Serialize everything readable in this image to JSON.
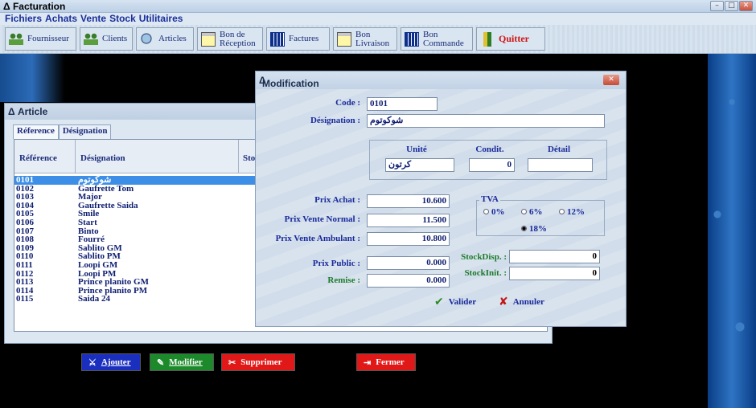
{
  "app": {
    "title": "Facturation"
  },
  "menu": [
    "Fichiers",
    "Achats",
    "Vente",
    "Stock",
    "Utilitaires"
  ],
  "toolbar": {
    "fournisseur": "Fournisseur",
    "clients": "Clients",
    "articles": "Articles",
    "bon_reception_1": "Bon de",
    "bon_reception_2": "Réception",
    "factures": "Factures",
    "bon_livraison_1": "Bon",
    "bon_livraison_2": "Livraison",
    "bon_commande_1": "Bon",
    "bon_commande_2": "Commande",
    "quitter": "Quitter"
  },
  "article_window": {
    "title": "Article",
    "tabs": [
      "Réference",
      "Désignation"
    ],
    "columns": [
      "Référence",
      "Désignation",
      "Sto"
    ],
    "rows": [
      {
        "ref": "0101",
        "designation": "شوكوتوم",
        "selected": true
      },
      {
        "ref": "0102",
        "designation": "Gaufrette Tom"
      },
      {
        "ref": "0103",
        "designation": "Major"
      },
      {
        "ref": "0104",
        "designation": "Gaufrette Saida"
      },
      {
        "ref": "0105",
        "designation": "Smile"
      },
      {
        "ref": "0106",
        "designation": "Start"
      },
      {
        "ref": "0107",
        "designation": "Binto"
      },
      {
        "ref": "0108",
        "designation": "Fourré"
      },
      {
        "ref": "0109",
        "designation": "Sablito GM"
      },
      {
        "ref": "0110",
        "designation": "Sablito PM"
      },
      {
        "ref": "0111",
        "designation": "Loopi GM"
      },
      {
        "ref": "0112",
        "designation": "Loopi PM"
      },
      {
        "ref": "0113",
        "designation": "Prince planito GM"
      },
      {
        "ref": "0114",
        "designation": "Prince planito PM"
      },
      {
        "ref": "0115",
        "designation": "Saida 24"
      }
    ],
    "buttons": {
      "ajouter": "Ajouter",
      "modifier": "Modifier",
      "supprimer": "Supprimer",
      "fermer": "Fermer"
    }
  },
  "dialog": {
    "title": "Modification",
    "code_label": "Code :",
    "code_value": "0101",
    "designation_label": "Désignation :",
    "designation_value": "شوكوتوم",
    "unite_label": "Unité",
    "unite_value": "كرتون",
    "condit_label": "Condit.",
    "condit_value": "0",
    "detail_label": "Détail",
    "detail_value": "",
    "prix_achat_label": "Prix Achat :",
    "prix_achat_value": "10.600",
    "prix_vente_normal_label": "Prix Vente Normal :",
    "prix_vente_normal_value": "11.500",
    "prix_vente_ambulant_label": "Prix Vente Ambulant :",
    "prix_vente_ambulant_value": "10.800",
    "prix_public_label": "Prix Public :",
    "prix_public_value": "0.000",
    "remise_label": "Remise :",
    "remise_value": "0.000",
    "tva_label": "TVA",
    "tva_options": [
      "0%",
      "6%",
      "12%",
      "18%"
    ],
    "tva_selected": "18%",
    "stock_disp_label": "StockDisp. :",
    "stock_disp_value": "0",
    "stock_init_label": "StockInit. :",
    "stock_init_value": "0",
    "valider": "Valider",
    "annuler": "Annuler"
  }
}
